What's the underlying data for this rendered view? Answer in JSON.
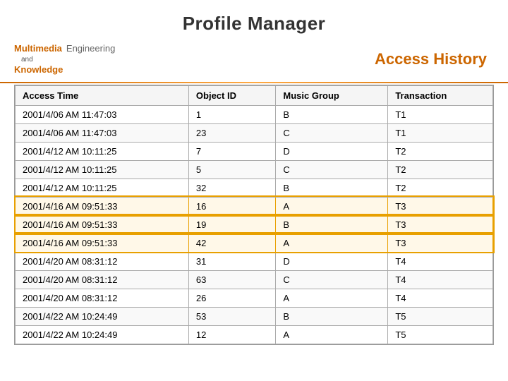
{
  "title": "Profile Manager",
  "access_history_label": "Access History",
  "logo": {
    "line1a": "Multimedia",
    "line1b": "Engineering",
    "line2a": "and",
    "line2b": "",
    "line3a": "Knowledge"
  },
  "table": {
    "headers": [
      "Access Time",
      "Object ID",
      "Music Group",
      "Transaction"
    ],
    "rows": [
      {
        "time": "2001/4/06 AM 11:47:03",
        "object_id": "1",
        "music_group": "B",
        "transaction": "T1",
        "highlight": false
      },
      {
        "time": "2001/4/06 AM 11:47:03",
        "object_id": "23",
        "music_group": "C",
        "transaction": "T1",
        "highlight": false
      },
      {
        "time": "2001/4/12 AM 10:11:25",
        "object_id": "7",
        "music_group": "D",
        "transaction": "T2",
        "highlight": false
      },
      {
        "time": "2001/4/12 AM 10:11:25",
        "object_id": "5",
        "music_group": "C",
        "transaction": "T2",
        "highlight": false
      },
      {
        "time": "2001/4/12 AM 10:11:25",
        "object_id": "32",
        "music_group": "B",
        "transaction": "T2",
        "highlight": false
      },
      {
        "time": "2001/4/16 AM 09:51:33",
        "object_id": "16",
        "music_group": "A",
        "transaction": "T3",
        "highlight": true
      },
      {
        "time": "2001/4/16 AM 09:51:33",
        "object_id": "19",
        "music_group": "B",
        "transaction": "T3",
        "highlight": true
      },
      {
        "time": "2001/4/16 AM 09:51:33",
        "object_id": "42",
        "music_group": "A",
        "transaction": "T3",
        "highlight": true
      },
      {
        "time": "2001/4/20 AM 08:31:12",
        "object_id": "31",
        "music_group": "D",
        "transaction": "T4",
        "highlight": false
      },
      {
        "time": "2001/4/20 AM 08:31:12",
        "object_id": "63",
        "music_group": "C",
        "transaction": "T4",
        "highlight": false
      },
      {
        "time": "2001/4/20 AM 08:31:12",
        "object_id": "26",
        "music_group": "A",
        "transaction": "T4",
        "highlight": false
      },
      {
        "time": "2001/4/22 AM 10:24:49",
        "object_id": "53",
        "music_group": "B",
        "transaction": "T5",
        "highlight": false
      },
      {
        "time": "2001/4/22 AM 10:24:49",
        "object_id": "12",
        "music_group": "A",
        "transaction": "T5",
        "highlight": false
      }
    ]
  }
}
